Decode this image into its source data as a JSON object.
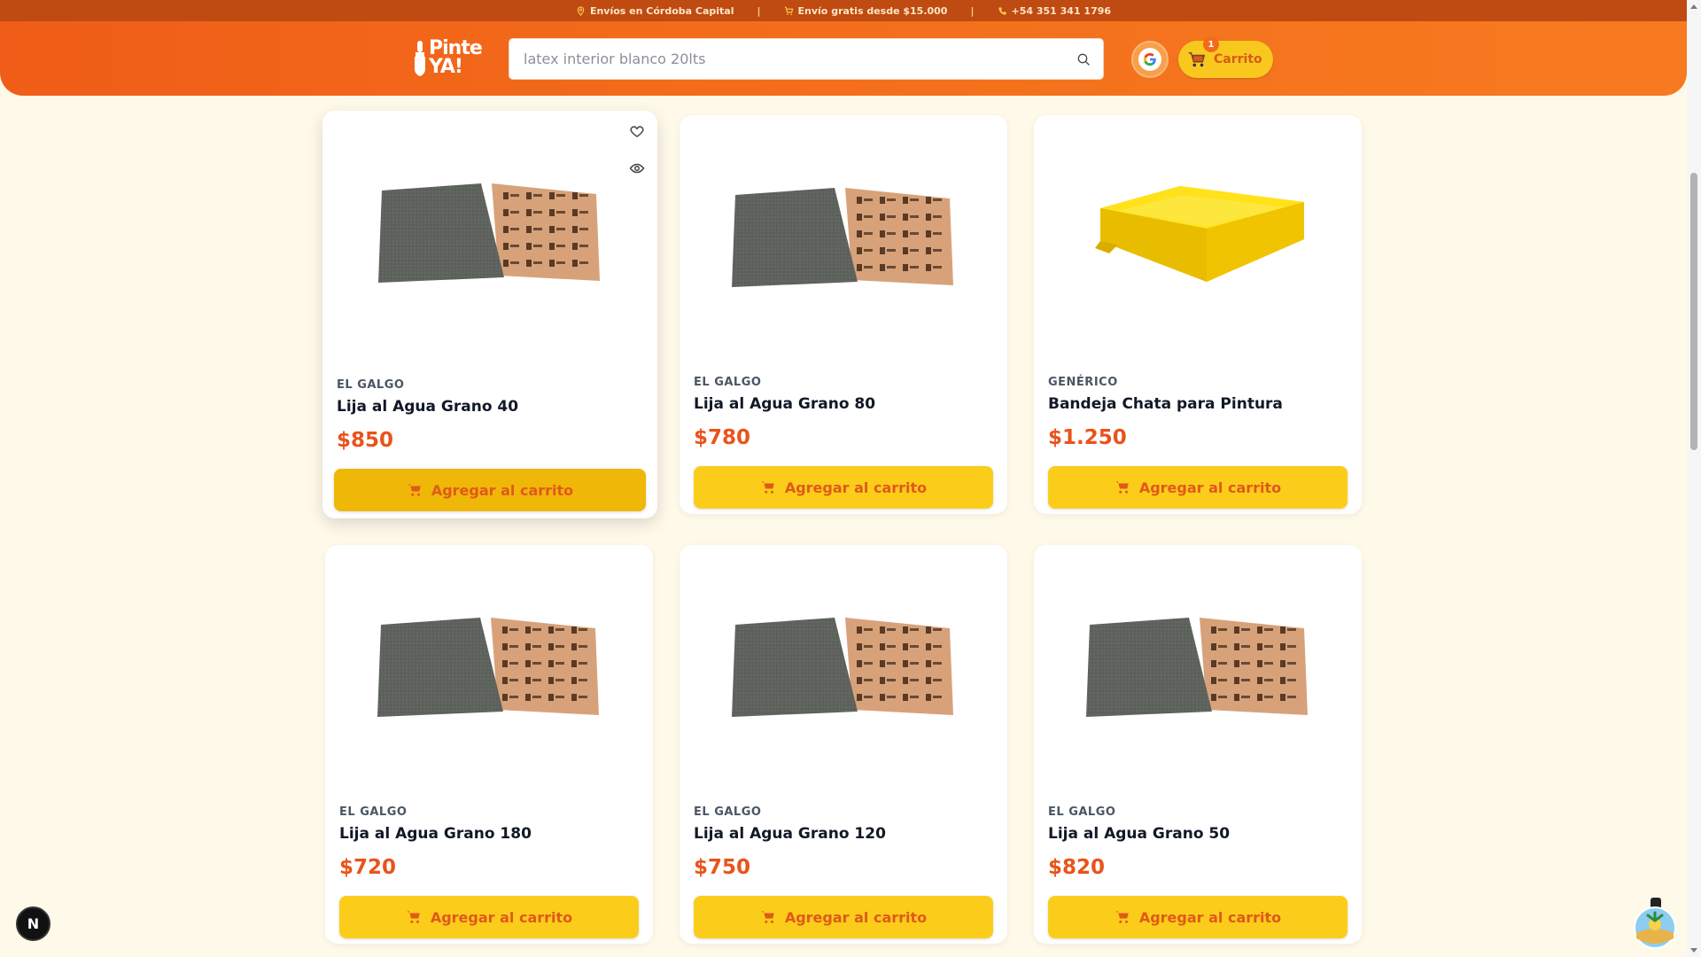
{
  "topbar": {
    "shipping_area": "Envíos en Córdoba Capital",
    "free_shipping": "Envío gratis desde $15.000",
    "phone": "+54 351 341 1796"
  },
  "header": {
    "logo_line1": "Pinte",
    "logo_line2": "YA!",
    "search_placeholder": "latex interior blanco 20lts",
    "cart_label": "Carrito",
    "cart_count": "1"
  },
  "products": [
    {
      "brand": "EL GALGO",
      "name": "Lija al Agua Grano 40",
      "price": "$850",
      "image": "sandpaper",
      "button": "Agregar al carrito"
    },
    {
      "brand": "EL GALGO",
      "name": "Lija al Agua Grano 80",
      "price": "$780",
      "image": "sandpaper",
      "button": "Agregar al carrito"
    },
    {
      "brand": "GENÉRICO",
      "name": "Bandeja Chata para Pintura",
      "price": "$1.250",
      "image": "paint-tray",
      "button": "Agregar al carrito"
    },
    {
      "brand": "EL GALGO",
      "name": "Lija al Agua Grano 180",
      "price": "$720",
      "image": "sandpaper",
      "button": "Agregar al carrito"
    },
    {
      "brand": "EL GALGO",
      "name": "Lija al Agua Grano 120",
      "price": "$750",
      "image": "sandpaper",
      "button": "Agregar al carrito"
    },
    {
      "brand": "EL GALGO",
      "name": "Lija al Agua Grano 50",
      "price": "$820",
      "image": "sandpaper",
      "button": "Agregar al carrito"
    }
  ],
  "dev_badge": "N",
  "colors": {
    "topbar": "#bf4a12",
    "header": "#f4701c",
    "button": "#fbcd1a",
    "price": "#e8541b",
    "page_bg": "#fff9ea"
  }
}
